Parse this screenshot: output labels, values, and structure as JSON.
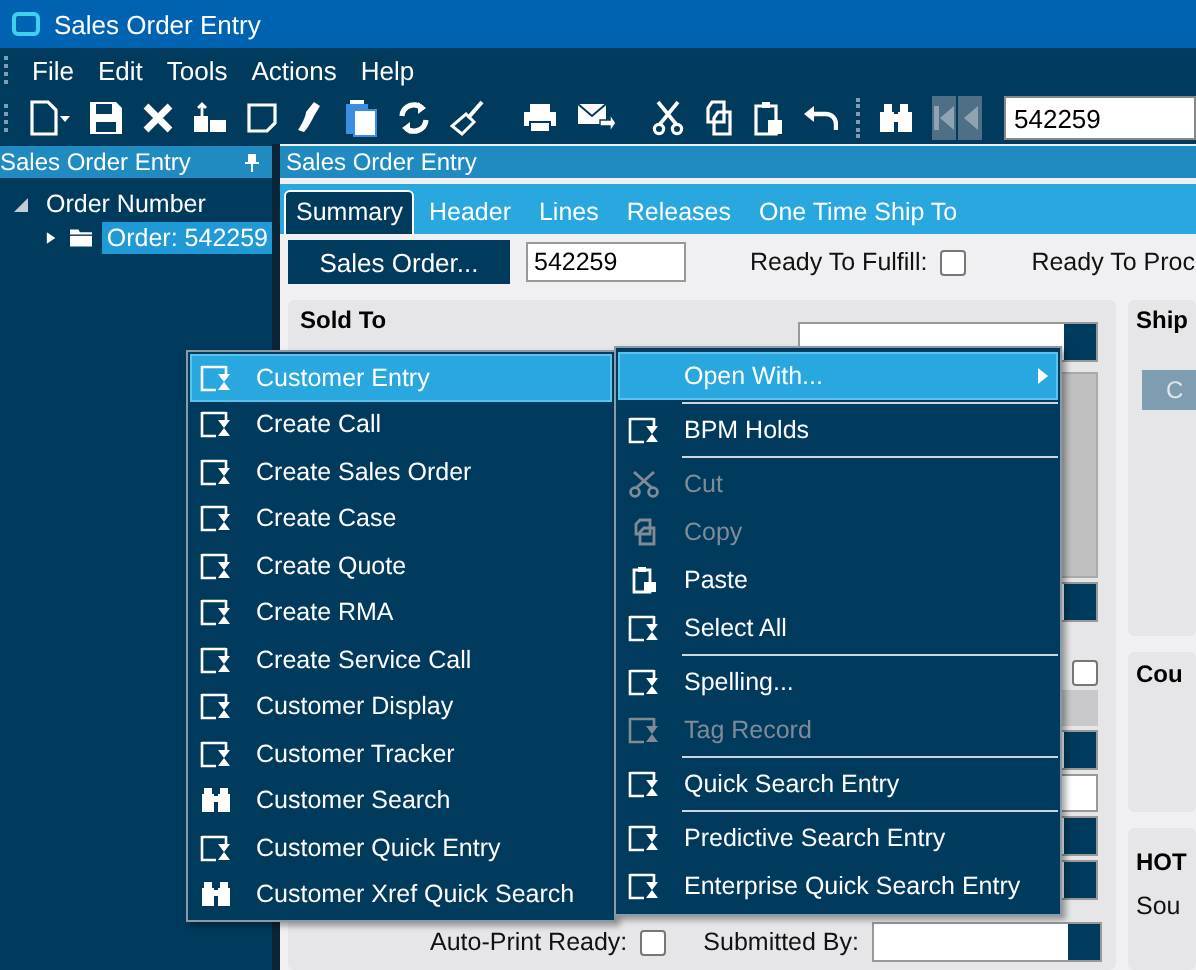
{
  "window": {
    "title": "Sales Order Entry"
  },
  "menu_bar": [
    {
      "label": "File"
    },
    {
      "label": "Edit"
    },
    {
      "label": "Tools"
    },
    {
      "label": "Actions"
    },
    {
      "label": "Help"
    }
  ],
  "toolbar": {
    "record_field": {
      "value": "542259"
    }
  },
  "navigator": {
    "title": "Sales Order Entry",
    "tree": [
      {
        "label": "Order Number",
        "expanded": true,
        "children": [
          {
            "label": "Order: 542259",
            "selected": true,
            "expanded": false
          }
        ]
      }
    ]
  },
  "form": {
    "title": "Sales Order Entry",
    "tabs": [
      {
        "label": "Summary",
        "selected": true
      },
      {
        "label": "Header",
        "selected": false
      },
      {
        "label": "Lines",
        "selected": false
      },
      {
        "label": "Releases",
        "selected": false
      },
      {
        "label": "One Time Ship To",
        "selected": false
      }
    ],
    "sales_order_button": "Sales Order...",
    "order_number": {
      "value": "542259"
    },
    "ready_to_fulfill": {
      "label": "Ready To Fulfill:",
      "checked": false
    },
    "ready_to_process": {
      "label": "Ready To Proc"
    },
    "sold_to": {
      "title": "Sold To",
      "option_checkbox": {
        "checked": false
      },
      "auto_print_ready": {
        "label": "Auto-Print Ready:",
        "checked": false
      },
      "submitted_by": {
        "label": "Submitted By:"
      }
    },
    "ship_to": {
      "title": "Ship",
      "button": "C"
    },
    "panel_3": {
      "title": "Cou"
    },
    "panel_4": {
      "title": "HOT",
      "text": "Sou"
    }
  },
  "open_with_submenu": {
    "items": [
      {
        "label": "Customer Entry",
        "kind": "form",
        "highlighted": true
      },
      {
        "label": "Create Call",
        "kind": "form",
        "highlighted": false
      },
      {
        "label": "Create Sales Order",
        "kind": "form",
        "highlighted": false
      },
      {
        "label": "Create Case",
        "kind": "form",
        "highlighted": false
      },
      {
        "label": "Create Quote",
        "kind": "form",
        "highlighted": false
      },
      {
        "label": "Create RMA",
        "kind": "form",
        "highlighted": false
      },
      {
        "label": "Create Service Call",
        "kind": "form",
        "highlighted": false
      },
      {
        "label": "Customer Display",
        "kind": "form",
        "highlighted": false
      },
      {
        "label": "Customer Tracker",
        "kind": "form",
        "highlighted": false
      },
      {
        "label": "Customer Search",
        "kind": "search",
        "highlighted": false
      },
      {
        "label": "Customer Quick Entry",
        "kind": "form",
        "highlighted": false
      },
      {
        "label": "Customer Xref Quick Search",
        "kind": "search",
        "highlighted": false
      }
    ]
  },
  "context_menu": {
    "items": [
      {
        "label": "Open With...",
        "kind": "submenu",
        "highlighted": true,
        "disabled": false,
        "separator_after": true
      },
      {
        "label": "BPM Holds",
        "kind": "form",
        "highlighted": false,
        "disabled": false,
        "separator_after": true
      },
      {
        "label": "Cut",
        "kind": "cut",
        "highlighted": false,
        "disabled": true,
        "separator_after": false
      },
      {
        "label": "Copy",
        "kind": "copy",
        "highlighted": false,
        "disabled": true,
        "separator_after": false
      },
      {
        "label": "Paste",
        "kind": "paste",
        "highlighted": false,
        "disabled": false,
        "separator_after": false
      },
      {
        "label": "Select All",
        "kind": "form",
        "highlighted": false,
        "disabled": false,
        "separator_after": true
      },
      {
        "label": "Spelling...",
        "kind": "form",
        "highlighted": false,
        "disabled": false,
        "separator_after": false
      },
      {
        "label": "Tag Record",
        "kind": "form",
        "highlighted": false,
        "disabled": true,
        "separator_after": true
      },
      {
        "label": "Quick Search Entry",
        "kind": "form",
        "highlighted": false,
        "disabled": false,
        "separator_after": true
      },
      {
        "label": "Predictive Search Entry",
        "kind": "form",
        "highlighted": false,
        "disabled": false,
        "separator_after": false
      },
      {
        "label": "Enterprise Quick Search Entry",
        "kind": "form",
        "highlighted": false,
        "disabled": false,
        "separator_after": false
      }
    ]
  }
}
